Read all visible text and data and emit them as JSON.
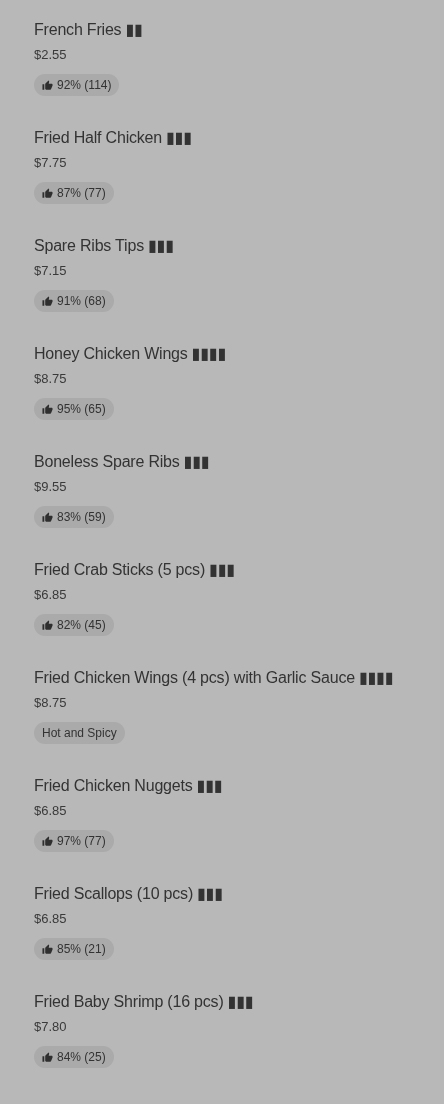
{
  "menu_items": [
    {
      "name": "French Fries ▮▮",
      "price": "$2.55",
      "badge": {
        "kind": "rating",
        "text": "92% (114)"
      }
    },
    {
      "name": "Fried Half Chicken ▮▮▮",
      "price": "$7.75",
      "badge": {
        "kind": "rating",
        "text": "87% (77)"
      }
    },
    {
      "name": "Spare Ribs Tips ▮▮▮",
      "price": "$7.15",
      "badge": {
        "kind": "rating",
        "text": "91% (68)"
      }
    },
    {
      "name": "Honey Chicken Wings ▮▮▮▮",
      "price": "$8.75",
      "badge": {
        "kind": "rating",
        "text": "95% (65)"
      }
    },
    {
      "name": "Boneless Spare Ribs ▮▮▮",
      "price": "$9.55",
      "badge": {
        "kind": "rating",
        "text": "83% (59)"
      }
    },
    {
      "name": "Fried Crab Sticks (5 pcs) ▮▮▮",
      "price": "$6.85",
      "badge": {
        "kind": "rating",
        "text": "82% (45)"
      }
    },
    {
      "name": "Fried Chicken Wings (4 pcs) with Garlic Sauce ▮▮▮▮",
      "price": "$8.75",
      "badge": {
        "kind": "tag",
        "text": "Hot and Spicy"
      }
    },
    {
      "name": "Fried Chicken Nuggets ▮▮▮",
      "price": "$6.85",
      "badge": {
        "kind": "rating",
        "text": "97% (77)"
      }
    },
    {
      "name": "Fried Scallops (10 pcs) ▮▮▮",
      "price": "$6.85",
      "badge": {
        "kind": "rating",
        "text": "85% (21)"
      }
    },
    {
      "name": "Fried Baby Shrimp (16 pcs) ▮▮▮",
      "price": "$7.80",
      "badge": {
        "kind": "rating",
        "text": "84% (25)"
      }
    }
  ]
}
